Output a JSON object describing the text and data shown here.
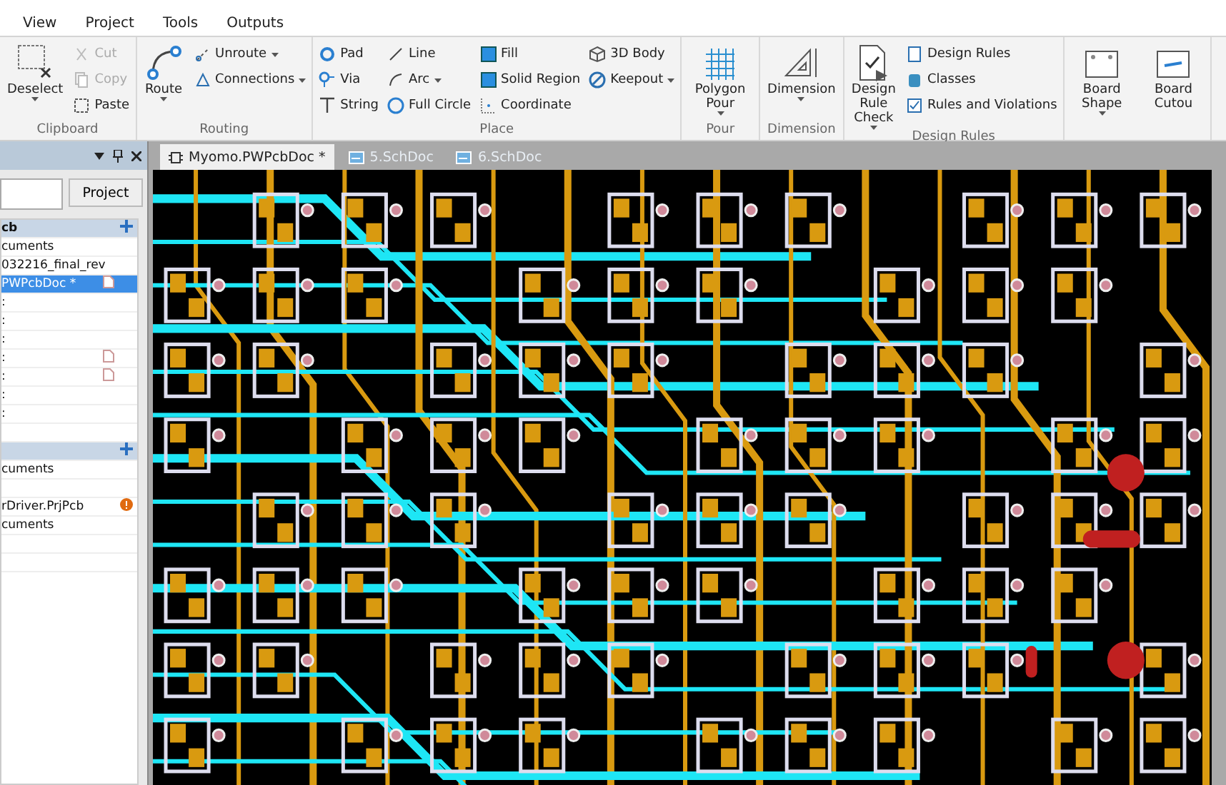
{
  "menu": [
    {
      "label": "View"
    },
    {
      "label": "Project"
    },
    {
      "label": "Tools"
    },
    {
      "label": "Outputs"
    }
  ],
  "ribbon": {
    "groups": [
      {
        "title": "Clipboard",
        "large": [
          {
            "label": "Deselect",
            "dropdown": true
          }
        ],
        "columns": [
          [
            {
              "label": "Cut",
              "disabled": true,
              "dropdown": false
            },
            {
              "label": "Copy",
              "disabled": true,
              "dropdown": false
            },
            {
              "label": "Paste",
              "disabled": false,
              "dropdown": false
            }
          ]
        ]
      },
      {
        "title": "Routing",
        "large": [
          {
            "label": "Route",
            "dropdown": true
          }
        ],
        "columns": [
          [
            {
              "label": "Unroute",
              "dropdown": true,
              "disabled": false
            },
            {
              "label": "Connections",
              "dropdown": true,
              "disabled": false
            }
          ]
        ]
      },
      {
        "title": "Place",
        "columns": [
          [
            {
              "label": "Pad",
              "disabled": false,
              "dropdown": false
            },
            {
              "label": "Via",
              "disabled": false,
              "dropdown": false
            },
            {
              "label": "String",
              "disabled": false,
              "dropdown": false
            }
          ],
          [
            {
              "label": "Line",
              "disabled": false,
              "dropdown": false
            },
            {
              "label": "Arc",
              "dropdown": true,
              "disabled": false
            },
            {
              "label": "Full Circle",
              "disabled": false,
              "dropdown": false
            }
          ],
          [
            {
              "label": "Fill",
              "disabled": false,
              "dropdown": false
            },
            {
              "label": "Solid Region",
              "disabled": false,
              "dropdown": false
            },
            {
              "label": "Coordinate",
              "disabled": false,
              "dropdown": false
            }
          ],
          [
            {
              "label": "3D Body",
              "disabled": false,
              "dropdown": false
            },
            {
              "label": "Keepout",
              "dropdown": true,
              "disabled": false
            }
          ]
        ]
      },
      {
        "title": "Pour",
        "large": [
          {
            "label": "Polygon Pour",
            "dropdown": true
          }
        ]
      },
      {
        "title": "Dimension",
        "large": [
          {
            "label": "Dimension",
            "dropdown": true
          }
        ]
      },
      {
        "title": "Design Rules",
        "large": [
          {
            "label": "Design Rule Check",
            "dropdown": true
          }
        ],
        "columns": [
          [
            {
              "label": "Design Rules",
              "disabled": false,
              "dropdown": false
            },
            {
              "label": "Classes",
              "disabled": false,
              "dropdown": false
            },
            {
              "label": "Rules and Violations",
              "disabled": false,
              "dropdown": false
            }
          ]
        ]
      },
      {
        "large": [
          {
            "label": "Board Shape",
            "dropdown": true
          },
          {
            "label": "Board Cutou",
            "dropdown": false
          }
        ]
      }
    ]
  },
  "panel": {
    "project_button": "Project",
    "rows": [
      {
        "kind": "group",
        "label": "cb",
        "selected": false
      },
      {
        "kind": "item",
        "label": "cuments",
        "selected": false
      },
      {
        "kind": "item",
        "label": "032216_final_rev",
        "selected": false
      },
      {
        "kind": "item",
        "label": "PWPcbDoc *",
        "selected": true,
        "file_icon": true
      },
      {
        "kind": "item",
        "label": ":",
        "selected": false
      },
      {
        "kind": "item",
        "label": ":",
        "selected": false
      },
      {
        "kind": "item",
        "label": ":",
        "selected": false
      },
      {
        "kind": "item",
        "label": ":",
        "selected": false,
        "file_icon": true
      },
      {
        "kind": "item",
        "label": ":",
        "selected": false,
        "file_icon": true
      },
      {
        "kind": "item",
        "label": ":",
        "selected": false
      },
      {
        "kind": "item",
        "label": ":",
        "selected": false
      },
      {
        "kind": "item",
        "selected": false
      },
      {
        "kind": "group",
        "selected": false
      },
      {
        "kind": "item",
        "label": "cuments",
        "selected": false
      },
      {
        "kind": "item",
        "selected": false
      },
      {
        "kind": "item",
        "label": "rDriver.PrjPcb",
        "selected": false,
        "warning": true
      },
      {
        "kind": "item",
        "label": "cuments",
        "selected": false
      },
      {
        "kind": "item",
        "selected": false
      },
      {
        "kind": "item",
        "selected": false
      }
    ]
  },
  "doc_tabs": [
    {
      "label": "Myomo.PWPcbDoc *",
      "kind": "pcb",
      "selected": true
    },
    {
      "label": "5.SchDoc",
      "kind": "sch",
      "selected": false
    },
    {
      "label": "6.SchDoc",
      "kind": "sch",
      "selected": false
    }
  ]
}
